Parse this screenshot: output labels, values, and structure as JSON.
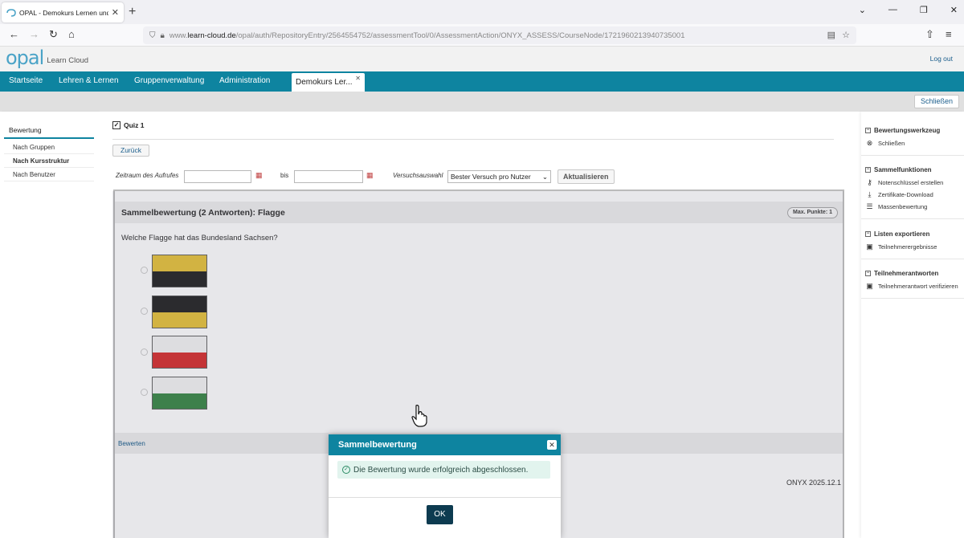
{
  "browser": {
    "tab_title": "OPAL - Demokurs Lernen und Pr",
    "url_prefix": "www.",
    "url_domain": "learn-cloud.de",
    "url_path": "/opal/auth/RepositoryEntry/2564554752/assessmentTool/0/AssessmentAction/ONYX_ASSESS/CourseNode/1721960213940735001"
  },
  "header": {
    "logo_text": "opal",
    "logo_sub": "Learn Cloud",
    "logout": "Log out"
  },
  "menu": {
    "items": [
      "Startseite",
      "Lehren & Lernen",
      "Gruppenverwaltung",
      "Administration"
    ],
    "active_tab": "Demokurs Ler..."
  },
  "subbar": {
    "close": "Schließen"
  },
  "leftnav": {
    "head": "Bewertung",
    "items": [
      "Nach Gruppen",
      "Nach Kursstruktur",
      "Nach Benutzer"
    ]
  },
  "content": {
    "quiz": "Quiz 1",
    "back": "Zurück",
    "range_label": "Zeitraum des Aufrufes",
    "to_label": "bis",
    "attempt_label": "Versuchsauswahl",
    "attempt_value": "Bester Versuch pro Nutzer",
    "refresh": "Aktualisieren"
  },
  "panel": {
    "title": "Sammelbewertung (2 Antworten): Flagge",
    "max_points": "Max. Punkte: 1",
    "question": "Welche Flagge hat das Bundesland Sachsen?",
    "flags": [
      {
        "top": "#e8c440",
        "bottom": "#2a2a2a"
      },
      {
        "top": "#2a2a2a",
        "bottom": "#e8c440"
      },
      {
        "top": "#f4f4f4",
        "bottom": "#d83434"
      },
      {
        "top": "#f4f4f4",
        "bottom": "#3e8a4a"
      }
    ],
    "footer_link": "Bewerten",
    "version": "ONYX 2025.12.1"
  },
  "rightside": {
    "groups": [
      {
        "head": "Bewertungswerkzeug",
        "items": [
          {
            "label": "Schließen",
            "icon": "close-circle-icon"
          }
        ]
      },
      {
        "head": "Sammelfunktionen",
        "items": [
          {
            "label": "Notenschlüssel erstellen",
            "icon": "key-icon"
          },
          {
            "label": "Zertifikate-Download",
            "icon": "download-icon"
          },
          {
            "label": "Massenbewertung",
            "icon": "list-icon"
          }
        ]
      },
      {
        "head": "Listen exportieren",
        "items": [
          {
            "label": "Teilnehmerergebnisse",
            "icon": "excel-icon"
          }
        ]
      },
      {
        "head": "Teilnehmerantworten",
        "items": [
          {
            "label": "Teilnehmerantwort verifizieren",
            "icon": "excel-icon"
          }
        ]
      }
    ]
  },
  "modal": {
    "title": "Sammelbewertung",
    "message": "Die Bewertung wurde erfolgreich abgeschlossen.",
    "ok": "OK"
  }
}
